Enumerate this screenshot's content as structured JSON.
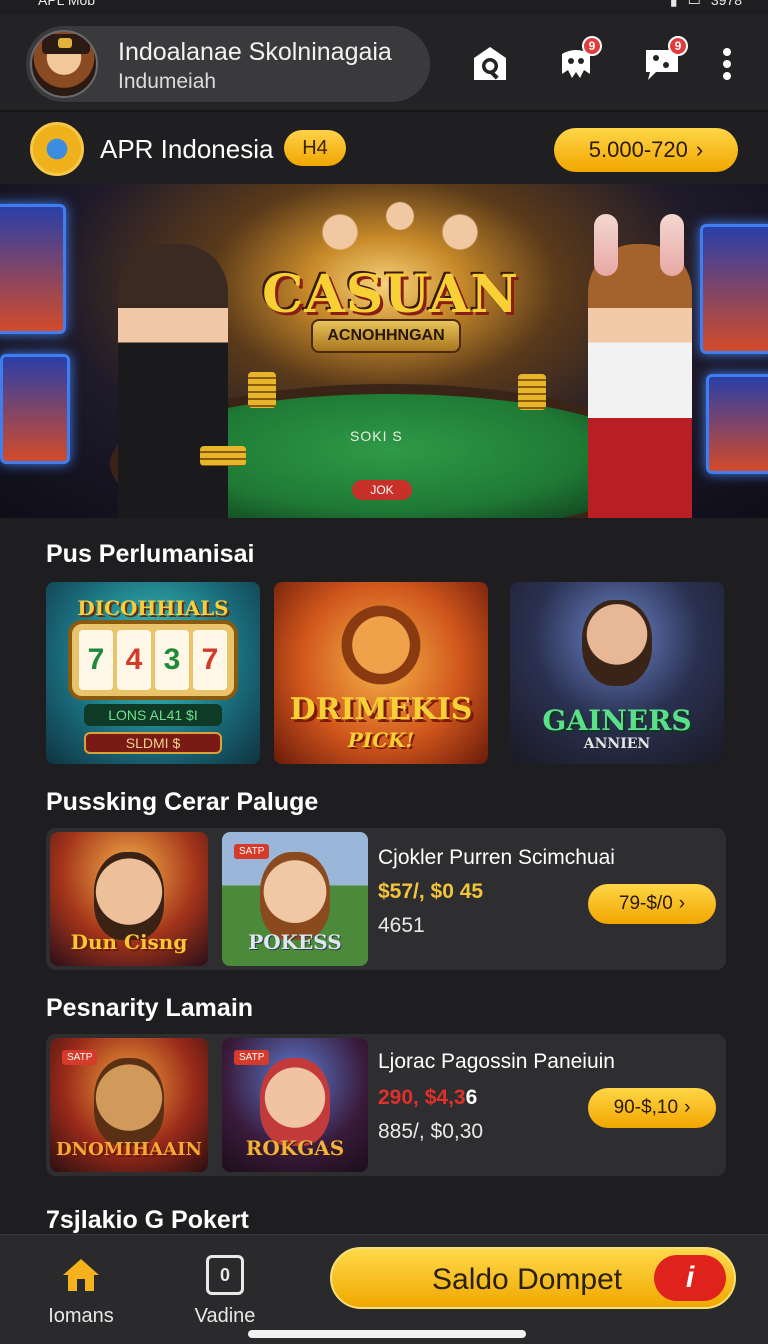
{
  "status_bar": {
    "left_text": "APL Mob",
    "right_text": "3978"
  },
  "header": {
    "user_name": "Indoalanae Skolninagaia",
    "user_sub": "Indumeiah",
    "notif_badge_1": "9",
    "notif_badge_2": "9"
  },
  "account": {
    "name": "APR Indonesia",
    "level": "H4",
    "balance_label": "5.000-720",
    "balance_arrow": "›"
  },
  "hero": {
    "logo_title": "CASUAN",
    "logo_ribbon": "ACNOHHNGAN",
    "table_text": "SOKI S",
    "oval_text": "JOK"
  },
  "section1": {
    "title": "Pus Perlumanisai",
    "tiles": [
      {
        "title": "DICOHHIALS",
        "reels": [
          "7",
          "4",
          "3",
          "7"
        ],
        "plate1": "LONS AL41 $I",
        "plate2": "SLDMI $"
      },
      {
        "title": "DRIMEKIS",
        "subtitle": "PICK!"
      },
      {
        "title": "GAINERS",
        "subtitle": "ANNIEN"
      }
    ]
  },
  "section2": {
    "title": "Pussking Cerar Paluge",
    "card": {
      "thumb1_label": "Dun Cisng",
      "thumb2_tag": "SATP",
      "thumb2_label": "POKESS",
      "title": "Cjokler Purren Scimchuai",
      "line1": "$57/, $0 45",
      "line2": "4651",
      "button": "79-$/0",
      "arrow": "›"
    }
  },
  "section3": {
    "title": "Pesnarity Lamain",
    "card": {
      "thumb1_tag": "SATP",
      "thumb1_label": "DNOMIHAAIN",
      "thumb2_tag": "SATP",
      "thumb2_label": "ROKGAS",
      "title": "Ljorac Pagossin Paneiuin",
      "line1_red": "290, $4,3",
      "line1_white": "6",
      "line2": "885/, $0,30",
      "button": "90-$,10",
      "arrow": "›"
    }
  },
  "section4": {
    "title": "7sjlakio G Pokert"
  },
  "bottom_nav": {
    "home_label": "Iomans",
    "vault_label": "Vadine",
    "vault_icon_text": "0",
    "wallet_label": "Saldo Dompet",
    "wallet_icon_text": "i"
  },
  "colors": {
    "accent_yellow": "#f2b21a",
    "badge_red": "#e23b3b",
    "price_yellow": "#f2c43a",
    "price_red": "#e0302a"
  }
}
